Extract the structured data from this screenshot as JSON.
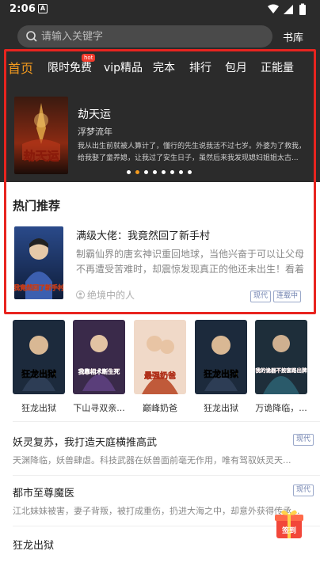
{
  "status_bar": {
    "time": "2:06",
    "notification_letter": "A"
  },
  "search": {
    "placeholder": "请输入关键字"
  },
  "header": {
    "bookstore_label": "书库"
  },
  "tabs": [
    {
      "label": "首页",
      "active": true
    },
    {
      "label": "限时免费",
      "badge": "hot"
    },
    {
      "label": "vip精品"
    },
    {
      "label": "完本"
    },
    {
      "label": "排行"
    },
    {
      "label": "包月"
    },
    {
      "label": "正能量"
    }
  ],
  "banner": {
    "title": "劫天运",
    "author": "浮梦流年",
    "description_line1": "我从出生前就被人算计了，懂行的先生说我活不过七岁。外婆为了救我，",
    "description_line2": "给我娶了童养媳，让我过了安生日子，虽然后来我发现媳妇姐姐太古...",
    "cover_text": "劫天运",
    "dots_count": 8,
    "active_dot": 1
  },
  "hot_section": {
    "title": "热门推荐",
    "book": {
      "title": "满级大佬：我竟然回了新手村",
      "description": "制霸仙界的唐玄神识重回地球，当他兴奋于可以让父母不再遭受苦难时，却震惊发现真正的他还未出生！看着老...",
      "author": "绝境中的人",
      "tags": [
        "现代",
        "连载中"
      ],
      "cover_text": "我竟然回了新手村"
    }
  },
  "grid_books": [
    {
      "title": "狂龙出狱",
      "cover_text": "狂龙出狱"
    },
    {
      "title": "下山寻双亲...",
      "cover_text": "我靠相术断生死"
    },
    {
      "title": "巅峰奶爸",
      "cover_text": "最强奶爸"
    },
    {
      "title": "狂龙出狱",
      "cover_text": "狂龙出狱"
    },
    {
      "title": "万诡降临，...",
      "cover_text": "我的诡器不按套路出牌"
    }
  ],
  "list_books": [
    {
      "title": "妖灵复苏，我打造天庭横推高武",
      "description": "天渊降临，妖兽肆虐。科技武器在妖兽面前毫无作用，唯有驾驭妖灵天...",
      "tag": "现代"
    },
    {
      "title": "都市至尊魔医",
      "description": "江北妹妹被害，妻子背叛，被打成重伤，扔进大海之中，却意外获得传承...",
      "tag": "现代"
    },
    {
      "title": "狂龙出狱",
      "description": "",
      "tag": ""
    }
  ],
  "floating": {
    "gift_label": "签到"
  },
  "colors": {
    "accent": "#f39a1e",
    "highlight": "#e8241f",
    "header_bg": "#2b2b2b"
  }
}
